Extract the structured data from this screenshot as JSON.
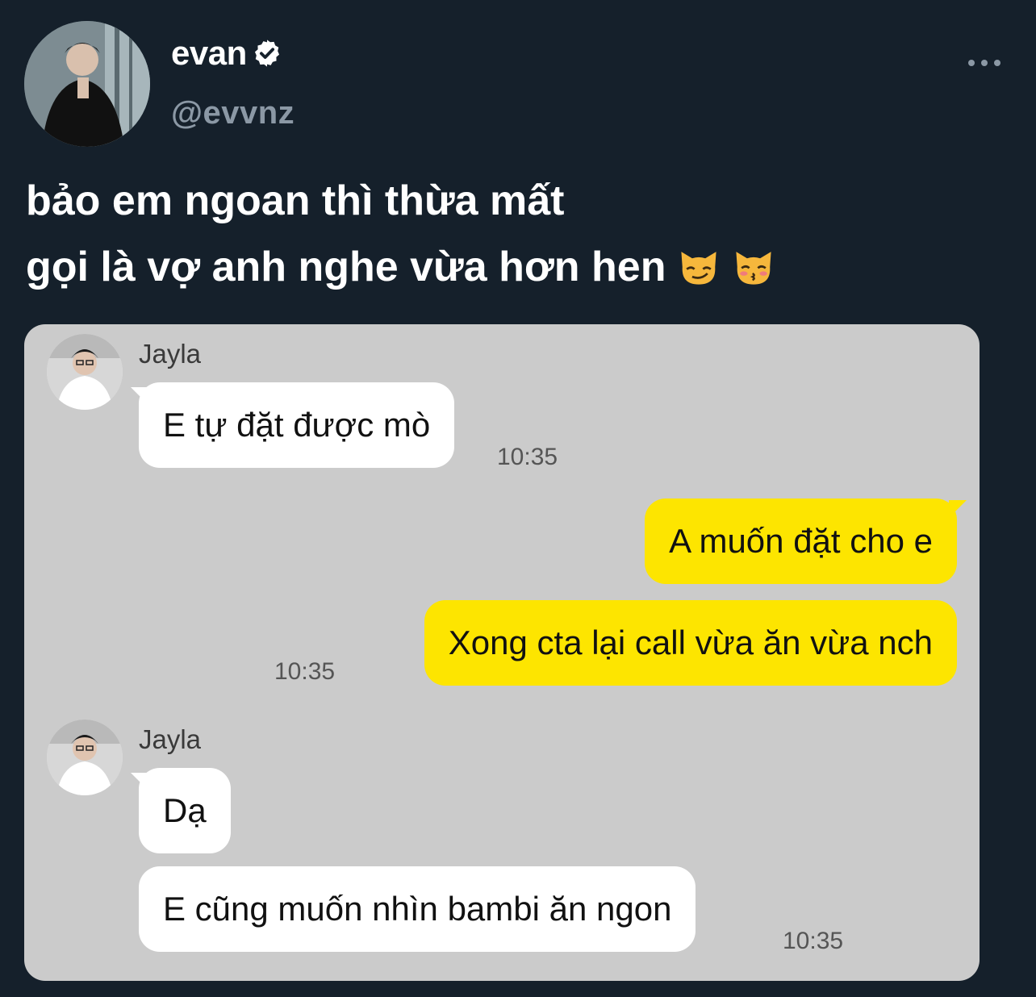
{
  "author": {
    "display_name": "evan",
    "handle": "@evvnz",
    "verified_icon": "verified-badge-icon",
    "avatar_icon": "profile-photo"
  },
  "tweet": {
    "line1": "bảo em ngoan thì thừa mất",
    "line2": "gọi là vợ anh nghe vừa hơn hen",
    "emojis": [
      "smirking-cat-face",
      "kissing-cat-face"
    ]
  },
  "menu": {
    "icon": "more-options-icon"
  },
  "chat": {
    "colors": {
      "background": "#cbcbcb",
      "incoming": "#ffffff",
      "outgoing": "#fde500"
    },
    "group1": {
      "sender": "Jayla",
      "message": "E tự đặt được mò",
      "time": "10:35"
    },
    "outgoing": {
      "message1": "A muốn đặt cho e",
      "message2": "Xong cta lại call vừa ăn vừa nch",
      "time": "10:35"
    },
    "group2": {
      "sender": "Jayla",
      "message1": "Dạ",
      "message2": "E cũng muốn nhìn bambi ăn ngon",
      "time": "10:35"
    }
  }
}
